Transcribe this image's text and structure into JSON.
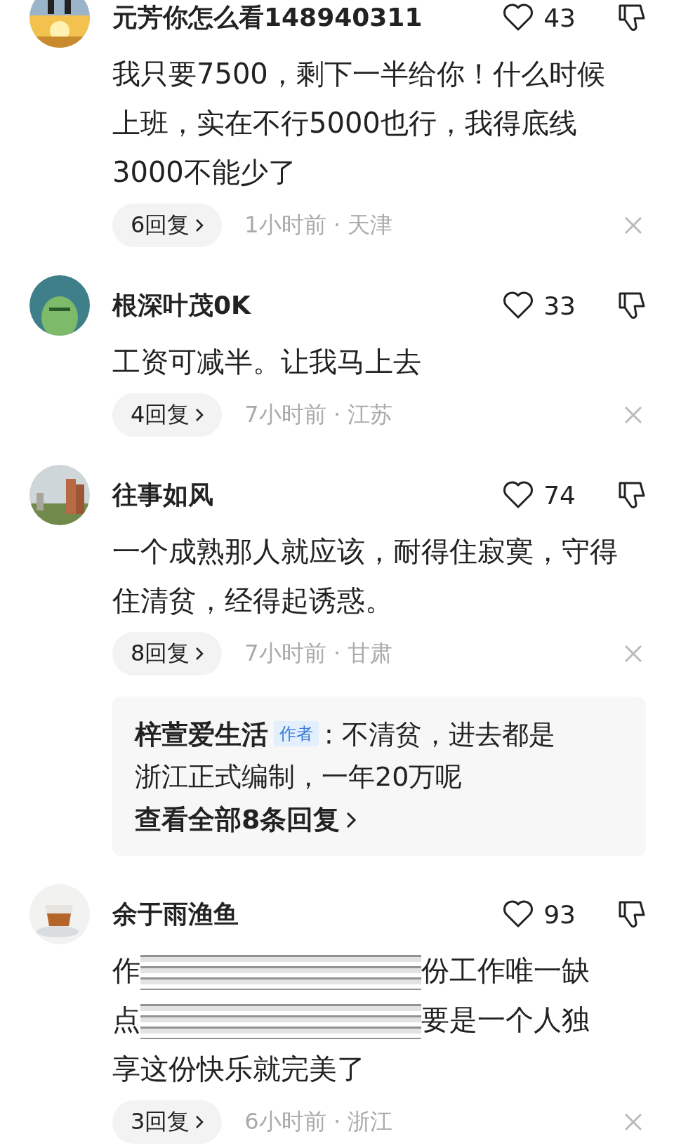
{
  "comments": [
    {
      "avatar": {
        "kind": "picture"
      },
      "name": "元芳你怎么看148940311",
      "likes": "43",
      "body": "我只要7500，剩下一半给你！什么时候上班，实在不行5000也行，我得底线3000不能少了",
      "replies": "6回复",
      "meta": "1小时前 · 天津"
    },
    {
      "avatar": {
        "kind": "picture"
      },
      "name": "根深叶茂0K",
      "likes": "33",
      "body": "工资可减半。让我马上去",
      "replies": "4回复",
      "meta": "7小时前 · 江苏"
    },
    {
      "avatar": {
        "kind": "picture"
      },
      "name": "往事如风",
      "likes": "74",
      "body": "一个成熟那人就应该，耐得住寂寞，守得住清贫，经得起诱惑。",
      "replies": "8回复",
      "meta": "7小时前 · 甘肃",
      "reply_box": {
        "author": "梓萱爱生活",
        "badge": "作者",
        "text": ": 不清贫，进去都是浙江正式编制，一年20万呢",
        "more": "查看全部8条回复"
      }
    },
    {
      "avatar": {
        "kind": "picture"
      },
      "name": "余于雨渔鱼",
      "likes": "93",
      "body_lines": [
        {
          "parts": [
            {
              "kind": "text",
              "text": "作"
            },
            {
              "kind": "redacted"
            },
            {
              "kind": "text",
              "text": "份工作唯一缺"
            }
          ]
        },
        {
          "parts": [
            {
              "kind": "text",
              "text": "点"
            },
            {
              "kind": "redacted"
            },
            {
              "kind": "text",
              "text": "要是一个人独"
            }
          ]
        },
        {
          "parts": [
            {
              "kind": "text",
              "text": "享这份快乐就完美了"
            }
          ]
        }
      ],
      "replies": "3回复",
      "meta": "6小时前 · 浙江"
    }
  ]
}
